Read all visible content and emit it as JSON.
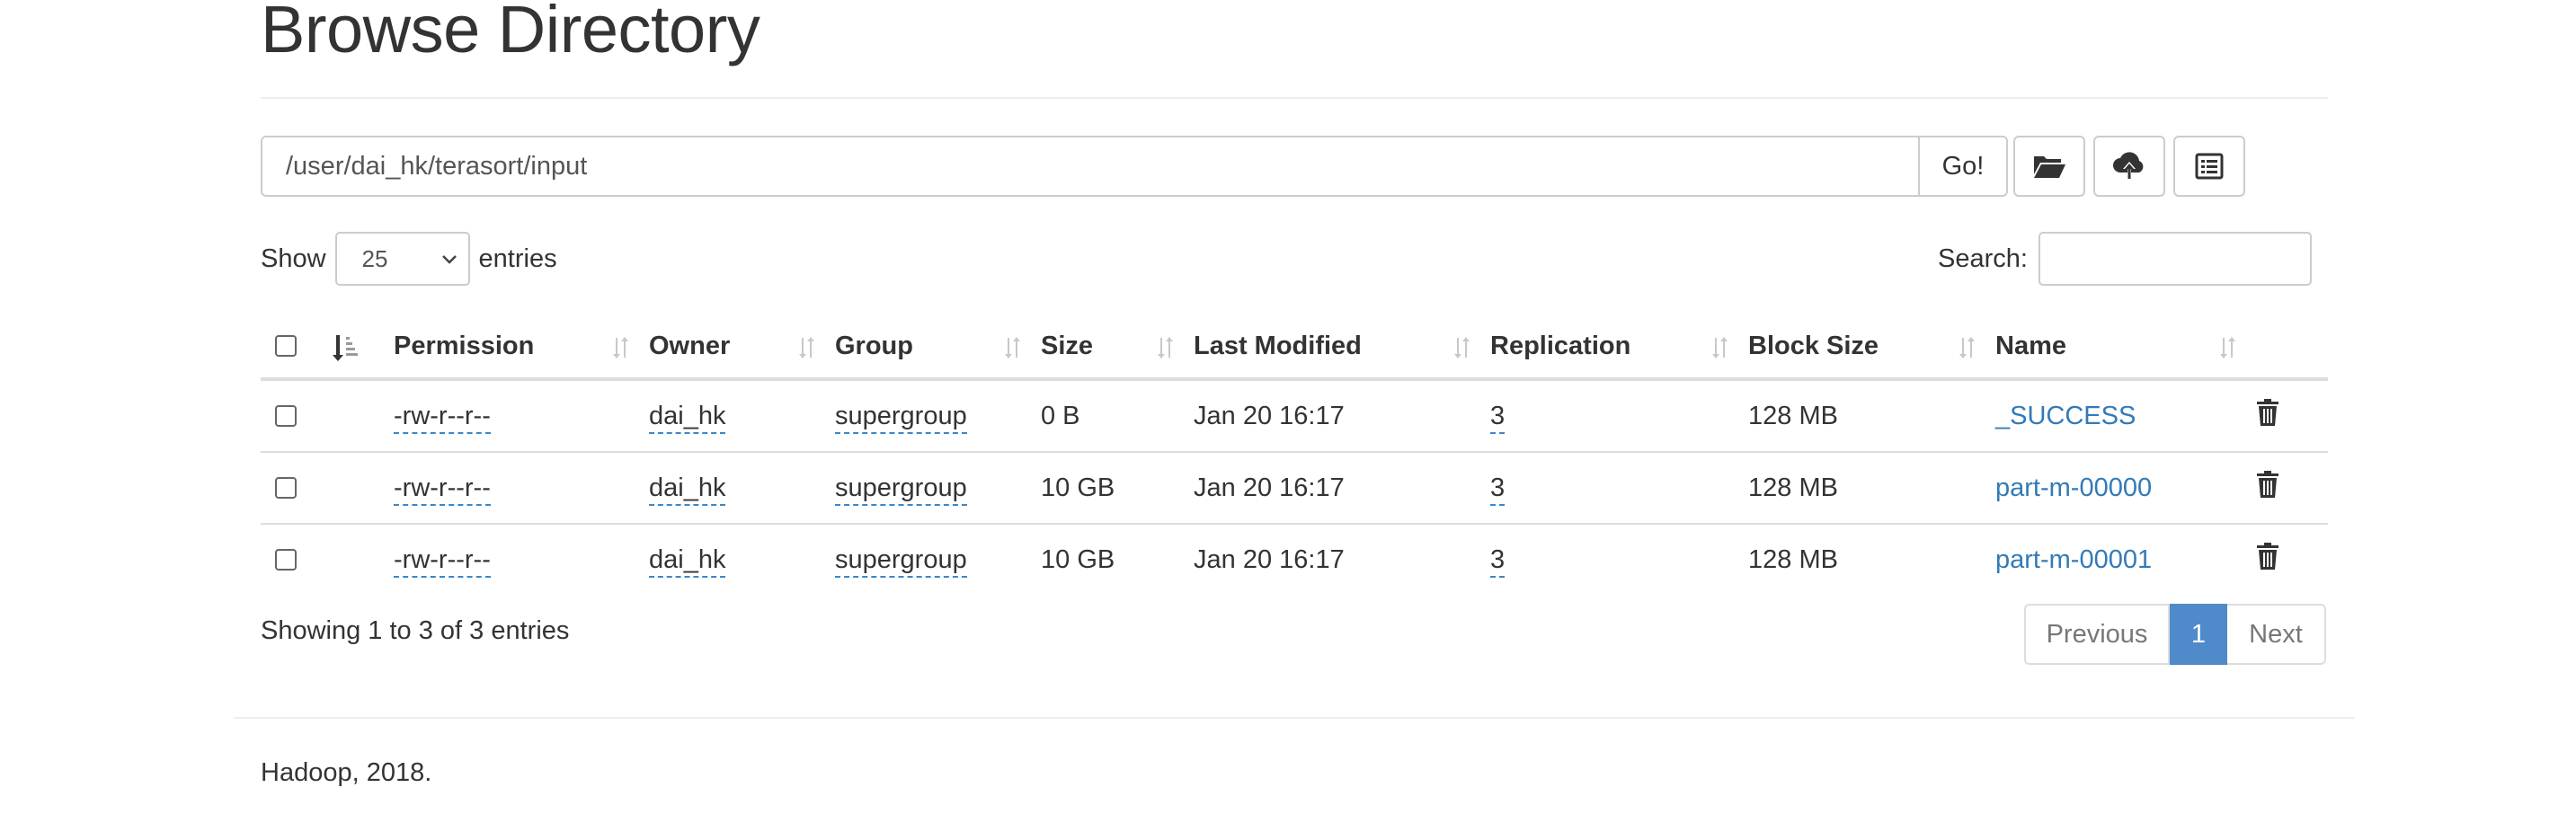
{
  "page": {
    "title": "Browse Directory"
  },
  "toolbar": {
    "path_value": "/user/dai_hk/terasort/input",
    "go_label": "Go!",
    "icons": [
      "folder-open-icon",
      "cloud-upload-icon",
      "list-alt-icon"
    ]
  },
  "length": {
    "show_label": "Show",
    "value": "25",
    "entries_label": "entries"
  },
  "search": {
    "label": "Search:",
    "value": ""
  },
  "table": {
    "columns": [
      "Permission",
      "Owner",
      "Group",
      "Size",
      "Last Modified",
      "Replication",
      "Block Size",
      "Name"
    ],
    "rows": [
      {
        "permission": "-rw-r--r--",
        "owner": "dai_hk",
        "group": "supergroup",
        "size": "0 B",
        "modified": "Jan 20 16:17",
        "replication": "3",
        "block_size": "128 MB",
        "name": "_SUCCESS"
      },
      {
        "permission": "-rw-r--r--",
        "owner": "dai_hk",
        "group": "supergroup",
        "size": "10 GB",
        "modified": "Jan 20 16:17",
        "replication": "3",
        "block_size": "128 MB",
        "name": "part-m-00000"
      },
      {
        "permission": "-rw-r--r--",
        "owner": "dai_hk",
        "group": "supergroup",
        "size": "10 GB",
        "modified": "Jan 20 16:17",
        "replication": "3",
        "block_size": "128 MB",
        "name": "part-m-00001"
      }
    ]
  },
  "info": "Showing 1 to 3 of 3 entries",
  "pagination": {
    "previous": "Previous",
    "current": "1",
    "next": "Next"
  },
  "footer": "Hadoop, 2018.",
  "colors": {
    "link": "#337ab7",
    "active_page": "#4f8acb"
  }
}
